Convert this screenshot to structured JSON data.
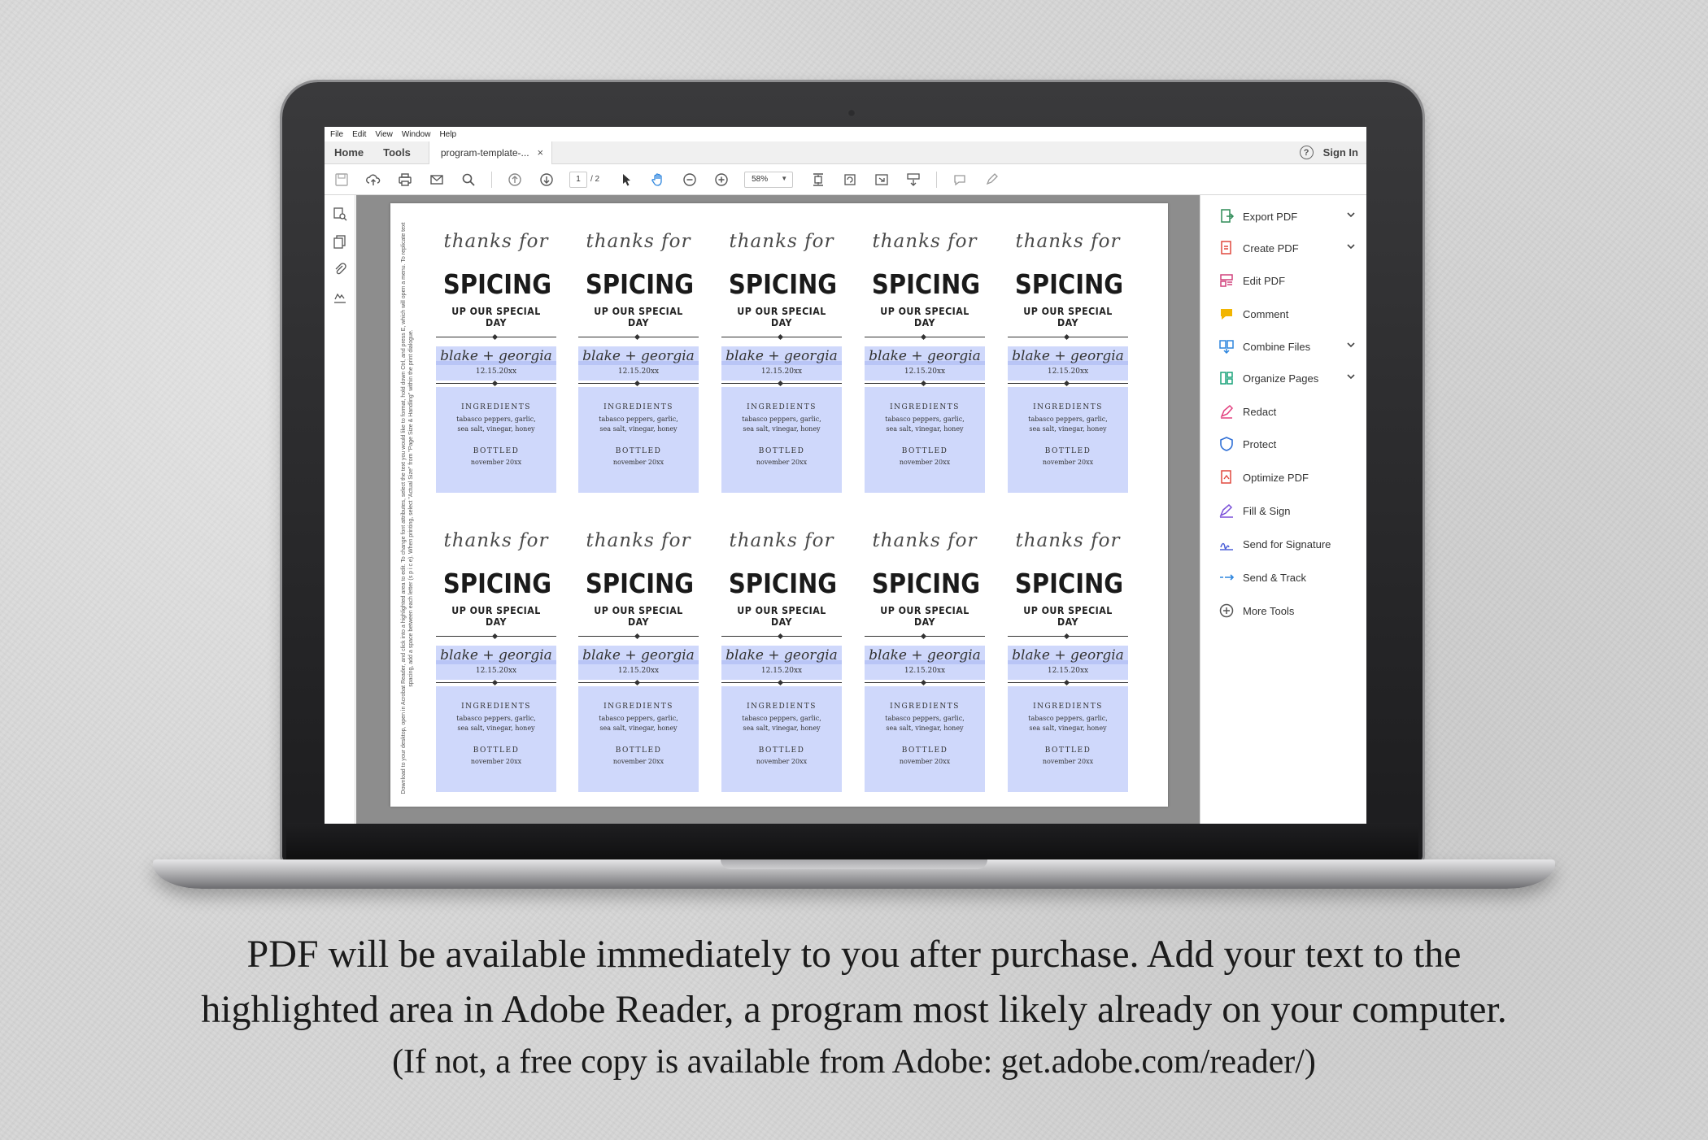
{
  "menu": [
    "File",
    "Edit",
    "View",
    "Window",
    "Help"
  ],
  "tabs": {
    "home": "Home",
    "tools": "Tools",
    "document": "program-template-...",
    "close": "×",
    "sign_in": "Sign In",
    "help": "?"
  },
  "toolbar": {
    "page_current": "1",
    "page_total": "/ 2",
    "zoom": "58%"
  },
  "side_note": "Download to your desktop, open in Acrobat Reader, and click into a highlighted area to edit. To change font attributes, select the text you would like to format, hold down Ctrl, and press E, which will open a menu. To replicate text spacing, add a space between each letter (s p i c e). When printing, select \"Actual Size\" from \"Page Size & Handling\" within the print dialogue.",
  "label": {
    "script": "thanks for",
    "headline": "SPICING",
    "subhead": "UP OUR SPECIAL DAY",
    "names": "blake + georgia",
    "date": "12.15.20xx",
    "ingredients_title": "INGREDIENTS",
    "ingredients_line1": "tabasco peppers, garlic,",
    "ingredients_line2": "sea salt, vinegar, honey",
    "bottled_title": "BOTTLED",
    "bottled_date": "november 20xx"
  },
  "tools_panel": [
    {
      "label": "Export PDF",
      "icon": "export-pdf-icon",
      "color": "#2e8b57",
      "has_menu": true
    },
    {
      "label": "Create PDF",
      "icon": "create-pdf-icon",
      "color": "#e0483e",
      "has_menu": true
    },
    {
      "label": "Edit PDF",
      "icon": "edit-pdf-icon",
      "color": "#d0417b",
      "has_menu": false
    },
    {
      "label": "Comment",
      "icon": "comment-icon",
      "color": "#f2b500",
      "has_menu": false
    },
    {
      "label": "Combine Files",
      "icon": "combine-files-icon",
      "color": "#2e86de",
      "has_menu": true
    },
    {
      "label": "Organize Pages",
      "icon": "organize-pages-icon",
      "color": "#1aa37a",
      "has_menu": true
    },
    {
      "label": "Redact",
      "icon": "redact-icon",
      "color": "#e2407f",
      "has_menu": false
    },
    {
      "label": "Protect",
      "icon": "protect-icon",
      "color": "#2f6fd6",
      "has_menu": false
    },
    {
      "label": "Optimize PDF",
      "icon": "optimize-pdf-icon",
      "color": "#e0483e",
      "has_menu": false
    },
    {
      "label": "Fill & Sign",
      "icon": "fill-sign-icon",
      "color": "#7a4fd8",
      "has_menu": false
    },
    {
      "label": "Send for Signature",
      "icon": "send-signature-icon",
      "color": "#4b5fd8",
      "has_menu": false
    },
    {
      "label": "Send & Track",
      "icon": "send-track-icon",
      "color": "#2e86de",
      "has_menu": false
    },
    {
      "label": "More Tools",
      "icon": "more-tools-icon",
      "color": "#555555",
      "has_menu": false
    }
  ],
  "caption": {
    "line1": "PDF will be available immediately to you after purchase.  Add your text to the",
    "line2": "highlighted area in Adobe Reader, a program most likely already on your computer.",
    "line3": "(If not, a free copy is available from Adobe: get.adobe.com/reader/)"
  },
  "colors": {
    "label_highlight": "#cfd8fb",
    "app_gray": "#8d8d8d"
  }
}
